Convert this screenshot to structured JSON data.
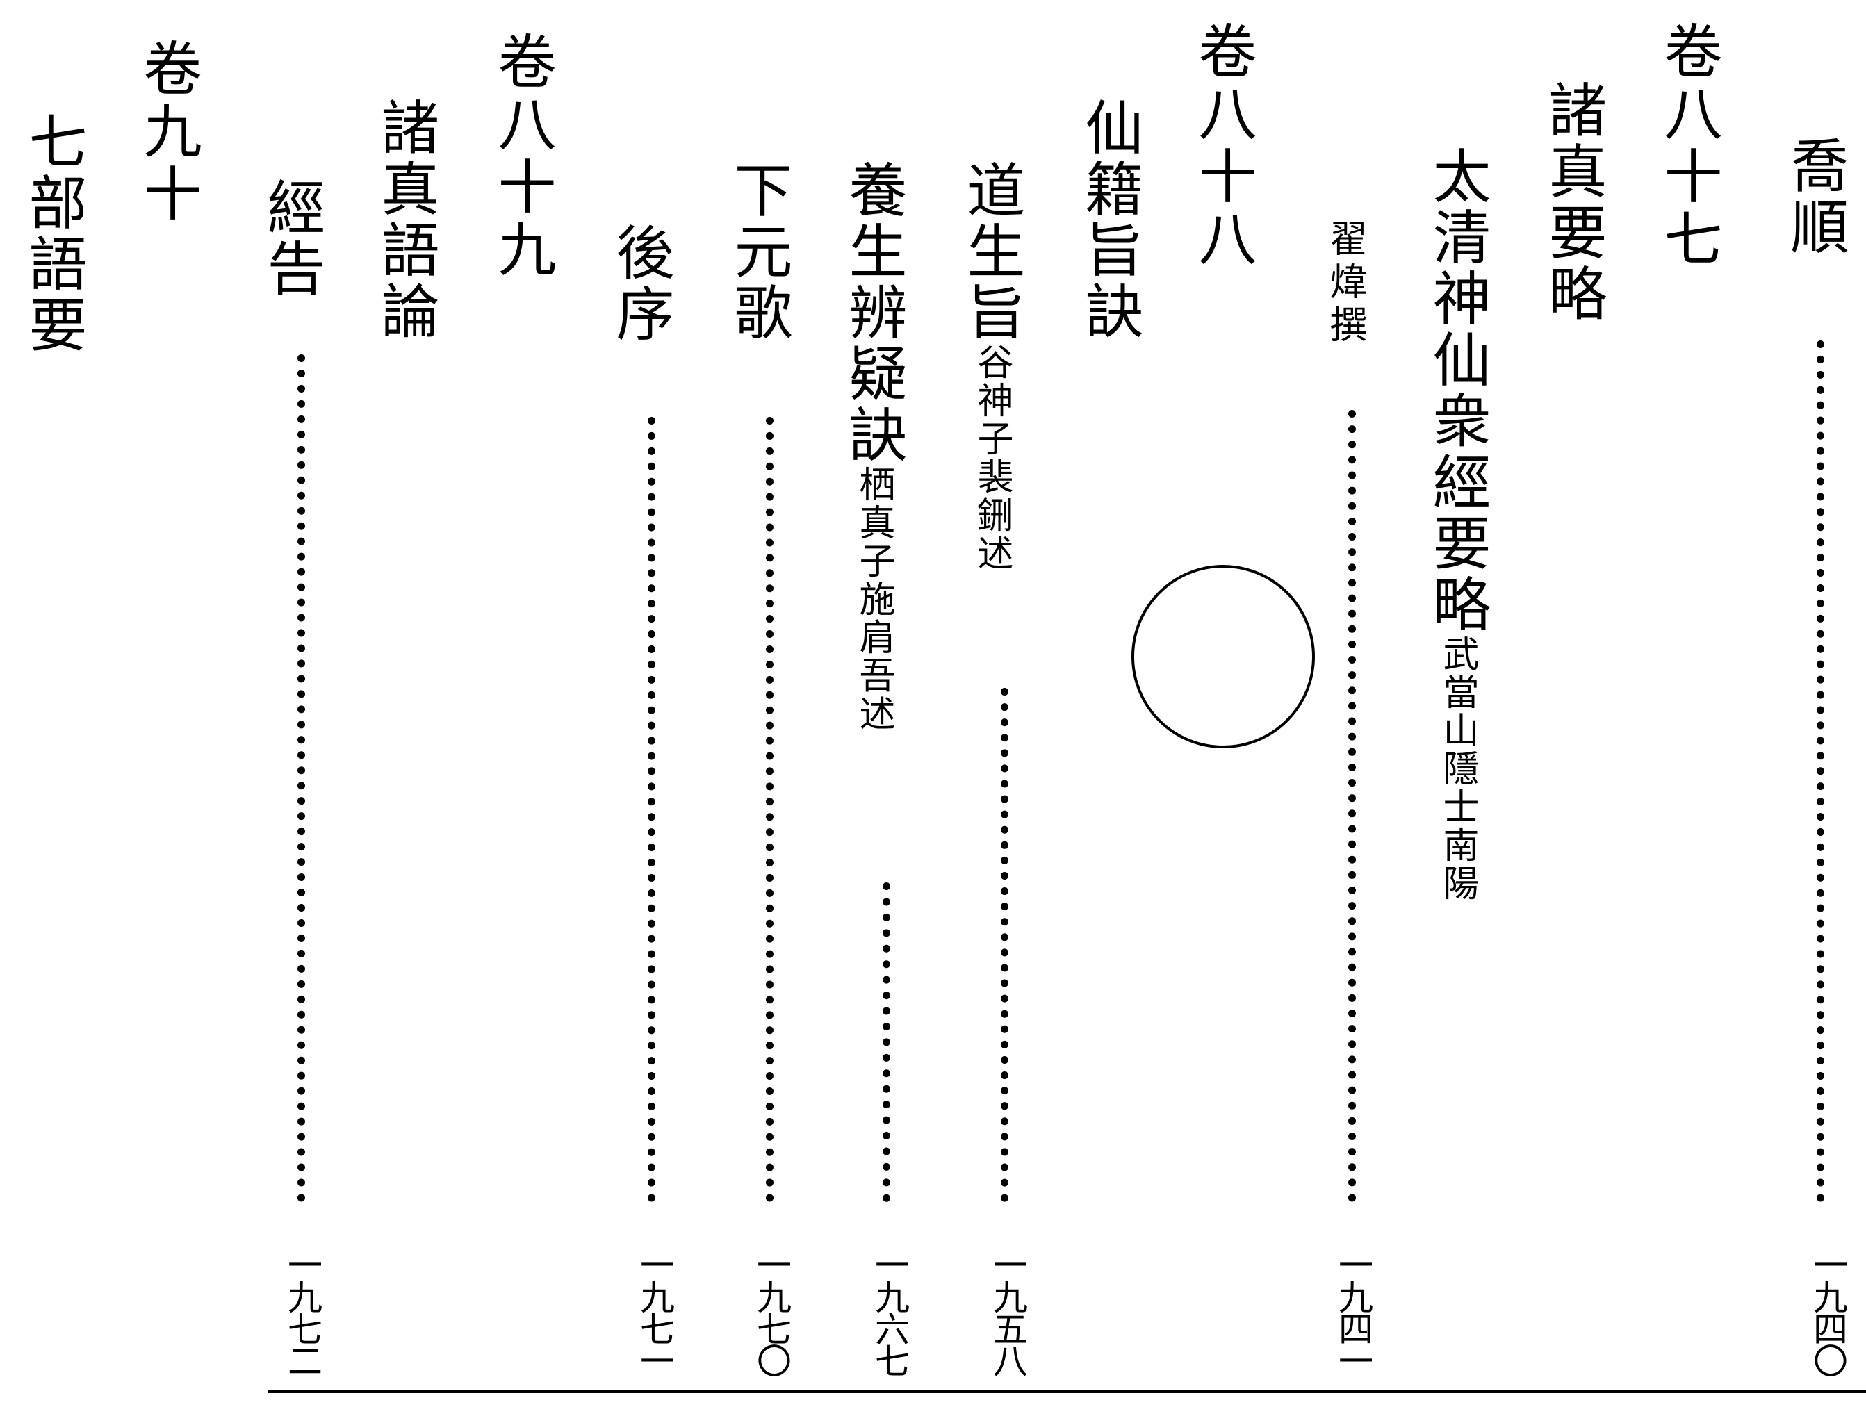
{
  "columns": [
    {
      "id": "c1",
      "main": "喬順",
      "note": "",
      "page": "一九四〇"
    },
    {
      "id": "c2",
      "main": "卷八十七",
      "note": "",
      "page": ""
    },
    {
      "id": "c3",
      "main": "諸真要略",
      "note": "",
      "page": ""
    },
    {
      "id": "c4",
      "main": "太清神仙衆經要略",
      "note": "武當山隱士南陽",
      "page": ""
    },
    {
      "id": "c5",
      "main": "翟煒撰",
      "note": "",
      "page": "一九四一"
    },
    {
      "id": "c6",
      "main": "卷八十八",
      "note": "",
      "page": ""
    },
    {
      "id": "c7",
      "main": "仙籍旨訣",
      "note": "",
      "page": ""
    },
    {
      "id": "c8",
      "main": "道生旨",
      "note": "谷神子裴鉶述",
      "page": "一九五八"
    },
    {
      "id": "c9",
      "main": "養生辨疑訣",
      "note": "栖真子施肩吾述",
      "page": "一九六七"
    },
    {
      "id": "c10",
      "main": "下元歌",
      "note": "",
      "page": "一九七〇"
    },
    {
      "id": "c11",
      "main": "後序",
      "note": "",
      "page": "一九七一"
    },
    {
      "id": "c12",
      "main": "卷八十九",
      "note": "",
      "page": ""
    },
    {
      "id": "c13",
      "main": "諸真語論",
      "note": "",
      "page": ""
    },
    {
      "id": "c14",
      "main": "經告",
      "note": "",
      "page": "一九七二"
    },
    {
      "id": "c15",
      "main": "卷九十",
      "note": "",
      "page": ""
    },
    {
      "id": "c16",
      "main": "七部語要",
      "note": "",
      "page": ""
    }
  ]
}
